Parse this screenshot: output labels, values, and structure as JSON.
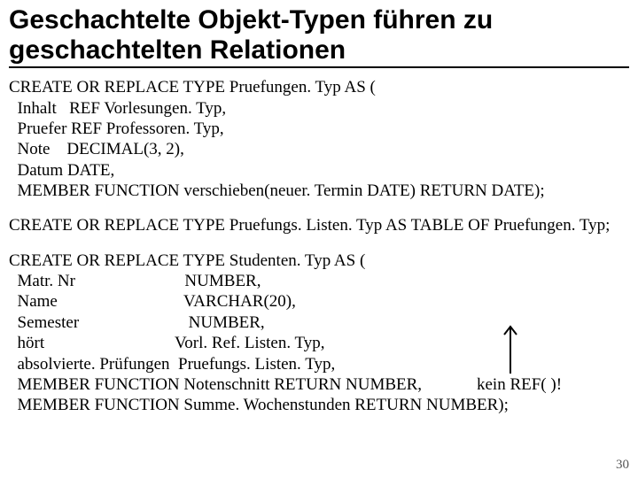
{
  "title_line1": "Geschachtelte Objekt-Typen führen zu",
  "title_line2": "geschachtelten Relationen",
  "block1": [
    "CREATE OR REPLACE TYPE Pruefungen. Typ AS (",
    "  Inhalt   REF Vorlesungen. Typ,",
    "  Pruefer REF Professoren. Typ,",
    "  Note    DECIMAL(3, 2),",
    "  Datum DATE,",
    "  MEMBER FUNCTION verschieben(neuer. Termin DATE) RETURN DATE);"
  ],
  "block2": [
    "CREATE OR REPLACE TYPE Pruefungs. Listen. Typ AS TABLE OF Pruefungen. Typ;"
  ],
  "block3": [
    "CREATE OR REPLACE TYPE Studenten. Typ AS (",
    "  Matr. Nr                          NUMBER,",
    "  Name                              VARCHAR(20),",
    "  Semester                          NUMBER,",
    "  hört                               Vorl. Ref. Listen. Typ,",
    "  absolvierte. Prüfungen  Pruefungs. Listen. Typ,",
    "  MEMBER FUNCTION Notenschnitt RETURN NUMBER,",
    "  MEMBER FUNCTION Summe. Wochenstunden RETURN NUMBER);"
  ],
  "callout_text": "kein REF( )!",
  "slide_number": "30"
}
